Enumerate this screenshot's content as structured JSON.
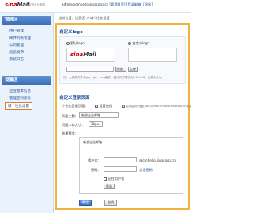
{
  "header": {
    "logo_main": "sina",
    "logo_mail": "Mail",
    "logo_sub": "新浪企业邮箱",
    "user": "admin@cmhello.sinacorp.cn",
    "links": [
      "[管理首页]",
      "[登录邮箱]",
      "[退出]"
    ]
  },
  "sidebar": {
    "section1": "管理区",
    "items1": [
      "用户管理",
      "邮件列表管理",
      "公司管理",
      "信息发布",
      "系统日志"
    ],
    "section2": "设置区",
    "items2": [
      "企业基本信息",
      "管理密码修改",
      "域个性化设置"
    ]
  },
  "breadcrumb": "当前位置：设置区 > 域个性化设置",
  "logo_section": {
    "title": "自定义logo",
    "option_default": "默认logo",
    "option_custom": "自定义logo",
    "upload_button": "浏览...",
    "submit_button": "上传",
    "hint": "注：上传的文件为jpg、gif、png格式，图片尺寸建议为170×49，文件大小为"
  },
  "login_section": {
    "title": "自定义登录页面",
    "personal_label": "个性化登录页面：",
    "personal_option": "设置使用",
    "personal_desc": "启用后用户通过http://mail.cmhello.sinacorp.cn登录",
    "page_title_label": "页面主题：",
    "page_title_value": "新浪企业邮箱",
    "font_size_label": "页面字体大小：",
    "font_size_value": "10px",
    "preview_label": "效果预览：",
    "preview": {
      "title": "新浪企业邮箱",
      "username_label": "用户名：",
      "domain": "@cmhello.sinacorp.cn",
      "password_label": "密码：",
      "forgot": "忘记密码",
      "remember": "记住用户名",
      "login_button": "登录"
    }
  },
  "actions": {
    "confirm": "确定",
    "cancel": "取消"
  }
}
